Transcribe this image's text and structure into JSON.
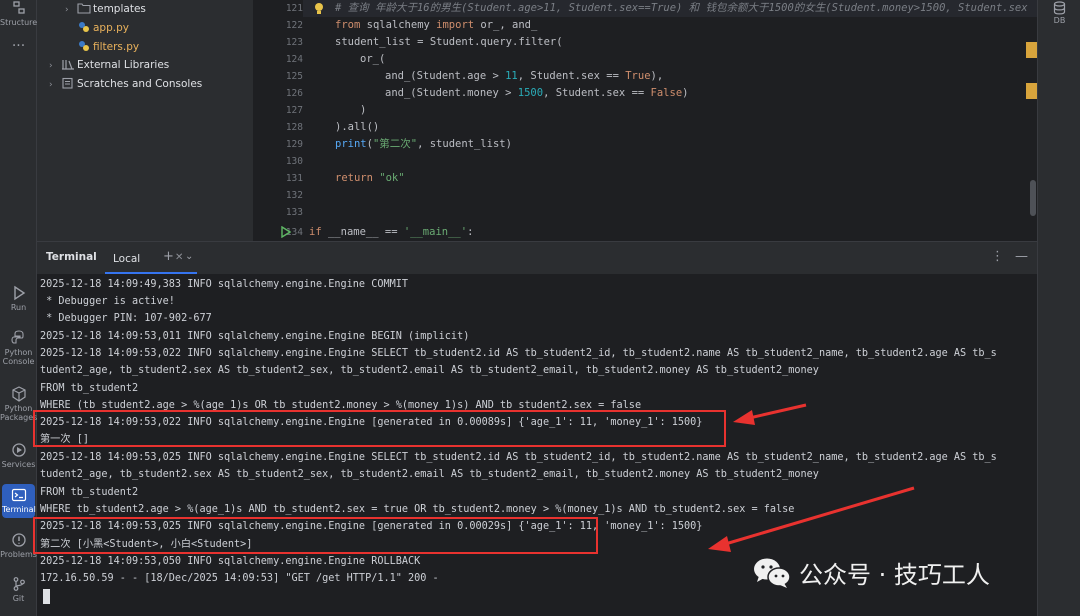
{
  "tool_strip": {
    "items": [
      {
        "label": "Structure",
        "icon": "structure-icon"
      },
      {
        "label": "...",
        "icon": "more-icon"
      },
      {
        "label": "Run",
        "icon": "run-icon"
      },
      {
        "label": "Python Console",
        "icon": "python-console-icon"
      },
      {
        "label": "Python Packages",
        "icon": "python-packages-icon"
      },
      {
        "label": "Services",
        "icon": "services-icon"
      },
      {
        "label": "Terminal",
        "icon": "terminal-icon"
      },
      {
        "label": "Problems",
        "icon": "problems-icon"
      },
      {
        "label": "Git",
        "icon": "git-icon"
      }
    ]
  },
  "project_tree": {
    "items": [
      {
        "label": "templates",
        "type": "folder"
      },
      {
        "label": "app.py",
        "type": "python"
      },
      {
        "label": "filters.py",
        "type": "python"
      },
      {
        "label": "External Libraries",
        "type": "library"
      },
      {
        "label": "Scratches and Consoles",
        "type": "scratch"
      }
    ]
  },
  "editor": {
    "line_numbers": [
      "121",
      "122",
      "123",
      "124",
      "125",
      "126",
      "127",
      "128",
      "129",
      "130",
      "131",
      "132",
      "133",
      "134"
    ],
    "code": {
      "l121": "# 查询 年龄大于16的男生(Student.age>11, Student.sex==True) 和 钱包余额大于1500的女生(Student.money>1500, Student.sex",
      "l122_kw1": "from",
      "l122_mod": " sqlalchemy ",
      "l122_kw2": "import",
      "l122_rest": " or_, and_",
      "l123": "student_list = Student.query.filter(",
      "l124": "or_(",
      "l125_a": "and_(Student.age > ",
      "l125_num": "11",
      "l125_b": ", Student.sex == ",
      "l125_kw": "True",
      "l125_c": "),",
      "l126_a": "and_(Student.money > ",
      "l126_num": "1500",
      "l126_b": ", Student.sex == ",
      "l126_kw": "False",
      "l126_c": ")",
      "l127": ")",
      "l128": ").all()",
      "l129_fn": "print",
      "l129_a": "(",
      "l129_str": "\"第二次\"",
      "l129_b": ", student_list)",
      "l131_kw": "return",
      "l131_str": " \"ok\"",
      "l134_kw": "if",
      "l134_a": " __name__ == ",
      "l134_str": "'__main__'",
      "l134_b": ":"
    }
  },
  "right_strip": {
    "db_label": "DB"
  },
  "terminal": {
    "title": "Terminal",
    "tab_label": "Local",
    "lines": [
      "2025-12-18 14:09:49,383 INFO sqlalchemy.engine.Engine COMMIT",
      " * Debugger is active!",
      " * Debugger PIN: 107-902-677",
      "2025-12-18 14:09:53,011 INFO sqlalchemy.engine.Engine BEGIN (implicit)",
      "2025-12-18 14:09:53,022 INFO sqlalchemy.engine.Engine SELECT tb_student2.id AS tb_student2_id, tb_student2.name AS tb_student2_name, tb_student2.age AS tb_s",
      "tudent2_age, tb_student2.sex AS tb_student2_sex, tb_student2.email AS tb_student2_email, tb_student2.money AS tb_student2_money",
      "FROM tb_student2",
      "WHERE (tb_student2.age > %(age_1)s OR tb_student2.money > %(money_1)s) AND tb_student2.sex = false",
      "2025-12-18 14:09:53,022 INFO sqlalchemy.engine.Engine [generated in 0.00089s] {'age_1': 11, 'money_1': 1500}",
      "第一次 []",
      "2025-12-18 14:09:53,025 INFO sqlalchemy.engine.Engine SELECT tb_student2.id AS tb_student2_id, tb_student2.name AS tb_student2_name, tb_student2.age AS tb_s",
      "tudent2_age, tb_student2.sex AS tb_student2_sex, tb_student2.email AS tb_student2_email, tb_student2.money AS tb_student2_money",
      "FROM tb_student2",
      "WHERE tb_student2.age > %(age_1)s AND tb_student2.sex = true OR tb_student2.money > %(money_1)s AND tb_student2.sex = false",
      "2025-12-18 14:09:53,025 INFO sqlalchemy.engine.Engine [generated in 0.00029s] {'age_1': 11, 'money_1': 1500}",
      "第二次 [小黑<Student>, 小白<Student>]",
      "2025-12-18 14:09:53,050 INFO sqlalchemy.engine.Engine ROLLBACK",
      "172.16.50.59 - - [18/Dec/2025 14:09:53] \"GET /get HTTP/1.1\" 200 -"
    ]
  },
  "watermark": {
    "text": "公众号 · 技巧工人"
  },
  "colors": {
    "annotation_red": "#e8322f",
    "accent_blue": "#3574f0"
  }
}
